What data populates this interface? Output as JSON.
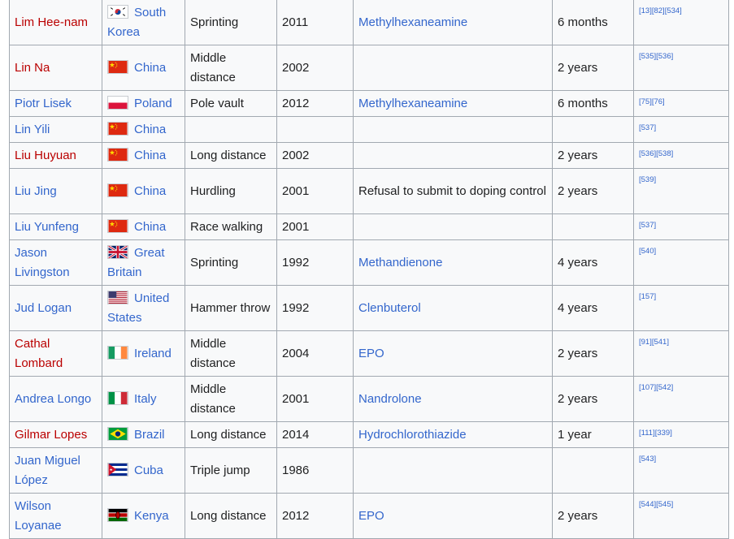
{
  "rows": [
    {
      "name": "Lim Hee-nam",
      "name_link": "red",
      "flag": "south-korea-flag-icon",
      "country": "South Korea",
      "event": "Sprinting",
      "year": "2011",
      "substance": "Methylhexaneamine",
      "ban": "6 months",
      "refs": "[13][82][534]",
      "height": 56
    },
    {
      "name": "Lin Na",
      "name_link": "red",
      "flag": "china-flag-icon",
      "country": "China",
      "event": "Middle distance",
      "year": "2002",
      "substance": "",
      "ban": "2 years",
      "refs": "[535][536]",
      "height": 56
    },
    {
      "name": "Piotr Lisek",
      "name_link": "blue",
      "flag": "poland-flag-icon",
      "country": "Poland",
      "event": "Pole vault",
      "year": "2012",
      "substance": "Methylhexaneamine",
      "ban": "6 months",
      "refs": "[75][76]",
      "height": 32
    },
    {
      "name": "Lin Yili",
      "name_link": "blue",
      "flag": "china-flag-icon",
      "country": "China",
      "event": "",
      "year": "",
      "substance": "",
      "ban": "",
      "refs": "[537]",
      "height": 32
    },
    {
      "name": "Liu Huyuan",
      "name_link": "red",
      "flag": "china-flag-icon",
      "country": "China",
      "event": "Long distance",
      "year": "2002",
      "substance": "",
      "ban": "2 years",
      "refs": "[536][538]",
      "height": 32
    },
    {
      "name": "Liu Jing",
      "name_link": "blue",
      "flag": "china-flag-icon",
      "country": "China",
      "event": "Hurdling",
      "year": "2001",
      "substance": "Refusal to submit to doping control",
      "ban": "2 years",
      "refs": "[539]",
      "height": 56
    },
    {
      "name": "Liu Yunfeng",
      "name_link": "blue",
      "flag": "china-flag-icon",
      "country": "China",
      "event": "Race walking",
      "year": "2001",
      "substance": "",
      "ban": "",
      "refs": "[537]",
      "height": 32
    },
    {
      "name": "Jason Livingston",
      "name_link": "blue",
      "flag": "great-britain-flag-icon",
      "country": "Great Britain",
      "event": "Sprinting",
      "year": "1992",
      "substance": "Methandienone",
      "ban": "4 years",
      "refs": "[540]",
      "height": 56
    },
    {
      "name": "Jud Logan",
      "name_link": "blue",
      "flag": "united-states-flag-icon",
      "country": "United States",
      "event": "Hammer throw",
      "year": "1992",
      "substance": "Clenbuterol",
      "ban": "4 years",
      "refs": "[157]",
      "height": 56
    },
    {
      "name": "Cathal Lombard",
      "name_link": "red",
      "flag": "ireland-flag-icon",
      "country": "Ireland",
      "event": "Middle distance",
      "year": "2004",
      "substance": "EPO",
      "ban": "2 years",
      "refs": "[91][541]",
      "height": 56
    },
    {
      "name": "Andrea Longo",
      "name_link": "blue",
      "flag": "italy-flag-icon",
      "country": "Italy",
      "event": "Middle distance",
      "year": "2001",
      "substance": "Nandrolone",
      "ban": "2 years",
      "refs": "[107][542]",
      "height": 56
    },
    {
      "name": "Gilmar Lopes",
      "name_link": "red",
      "flag": "brazil-flag-icon",
      "country": "Brazil",
      "event": "Long distance",
      "year": "2014",
      "substance": "Hydrochlorothiazide",
      "ban": "1 year",
      "refs": "[111][339]",
      "height": 32
    },
    {
      "name": "Juan Miguel López",
      "name_link": "blue",
      "flag": "cuba-flag-icon",
      "country": "Cuba",
      "event": "Triple jump",
      "year": "1986",
      "substance": "",
      "ban": "",
      "refs": "[543]",
      "height": 56
    },
    {
      "name": "Wilson Loyanae",
      "name_link": "blue",
      "flag": "kenya-flag-icon",
      "country": "Kenya",
      "event": "Long distance",
      "year": "2012",
      "substance": "EPO",
      "ban": "2 years",
      "refs": "[544][545]",
      "height": 56
    }
  ]
}
